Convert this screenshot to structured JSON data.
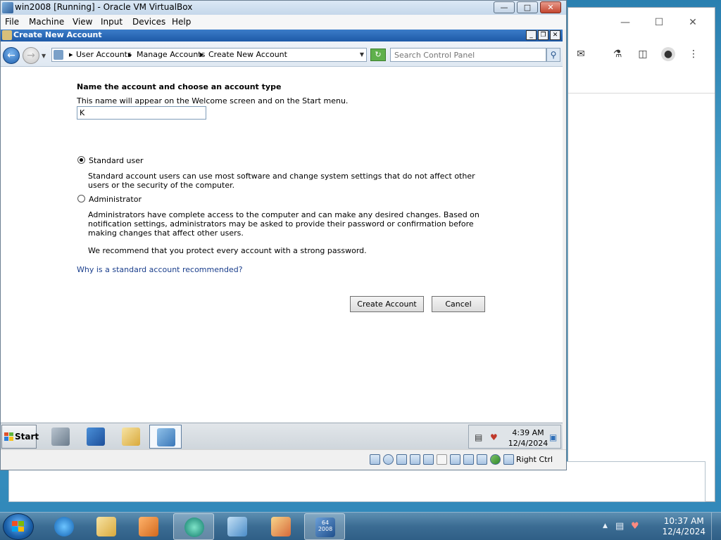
{
  "vbox": {
    "title": "win2008 [Running] - Oracle VM VirtualBox",
    "menu": [
      "File",
      "Machine",
      "View",
      "Input",
      "Devices",
      "Help"
    ],
    "status": {
      "host_key": "Right Ctrl"
    }
  },
  "guest_window": {
    "title": "Create New Account",
    "breadcrumb": [
      "User Accounts",
      "Manage Accounts",
      "Create New Account"
    ],
    "search": {
      "placeholder": "Search Control Panel"
    }
  },
  "form": {
    "heading": "Name the account and choose an account type",
    "description": "This name will appear on the Welcome screen and on the Start menu.",
    "name_value": "K",
    "options": [
      {
        "label": "Standard user",
        "selected": true,
        "description": "Standard account users can use most software and change system settings that do not affect other users or the security of the computer."
      },
      {
        "label": "Administrator",
        "selected": false,
        "description": "Administrators have complete access to the computer and can make any desired changes. Based on notification settings, administrators may be asked to provide their password or confirmation before making changes that affect other users."
      }
    ],
    "recommendation": "We recommend that you protect every account with a strong password.",
    "link": "Why is a standard account recommended?",
    "create_label": "Create Account",
    "cancel_label": "Cancel"
  },
  "guest_taskbar": {
    "start_label": "Start",
    "time": "4:39 AM",
    "date": "12/4/2024"
  },
  "host_taskbar": {
    "time": "10:37 AM",
    "date": "12/4/2024",
    "vm_badge_number": "64",
    "vm_badge_label": "2008"
  },
  "colors": {
    "guest_titlebar": "#1e5aa8",
    "link": "#1a3e8c",
    "host_taskbar": "#3b6c93"
  }
}
